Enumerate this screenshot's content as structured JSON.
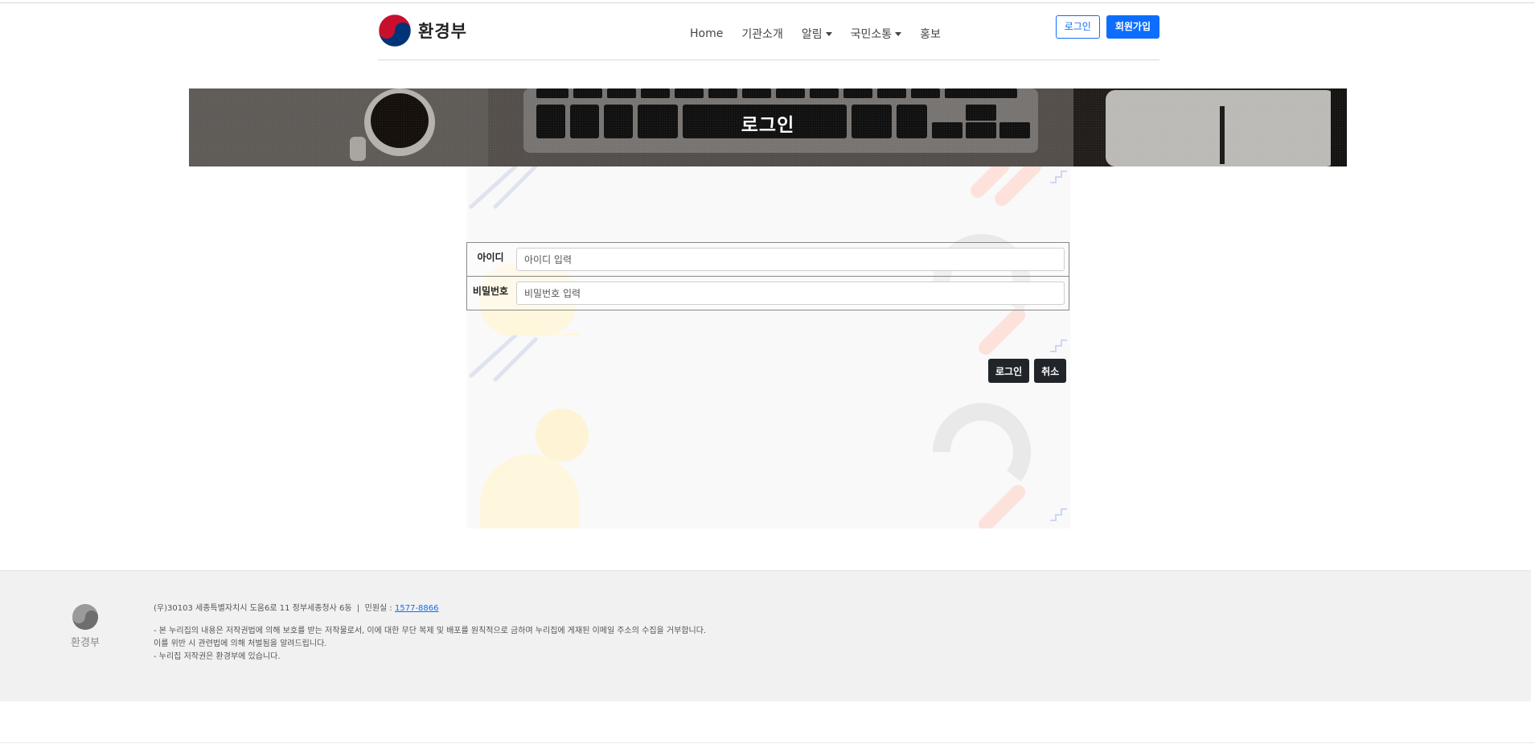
{
  "header": {
    "logo_text": "환경부",
    "nav": [
      {
        "label": "Home",
        "has_caret": false
      },
      {
        "label": "기관소개",
        "has_caret": false
      },
      {
        "label": "알림",
        "has_caret": true
      },
      {
        "label": "국민소통",
        "has_caret": true
      },
      {
        "label": "홍보",
        "has_caret": false
      }
    ],
    "login_label": "로그인",
    "signup_label": "회원가입"
  },
  "banner": {
    "title": "로그인"
  },
  "form": {
    "id_label": "아이디",
    "id_placeholder": "아이디 입력",
    "pw_label": "비밀번호",
    "pw_placeholder": "비밀번호 입력",
    "login_button": "로그인",
    "cancel_button": "취소"
  },
  "footer": {
    "logo_text": "환경부",
    "address": "(우)30103 세종특별자치시 도움6로 11 정부세종청사 6동",
    "separator": "|",
    "phone_label": "민원실 :",
    "phone": "1577-8866",
    "notice_1": "- 본 누리집의 내용은 저작권법에 의해 보호를 받는 저작물로서, 이에 대한 무단 복제 및 배포를 원칙적으로 금하며 누리집에 게재된 이메일 주소의 수집을 거부합니다.",
    "notice_2": "이를 위반 시 관련법에 의해 처벌됨을 알려드립니다.",
    "notice_3": "- 누리집 저작권은 환경부에 있습니다."
  },
  "colors": {
    "primary": "#0d6efd",
    "dark_button": "#212529",
    "footer_bg": "#f1f1f1"
  }
}
